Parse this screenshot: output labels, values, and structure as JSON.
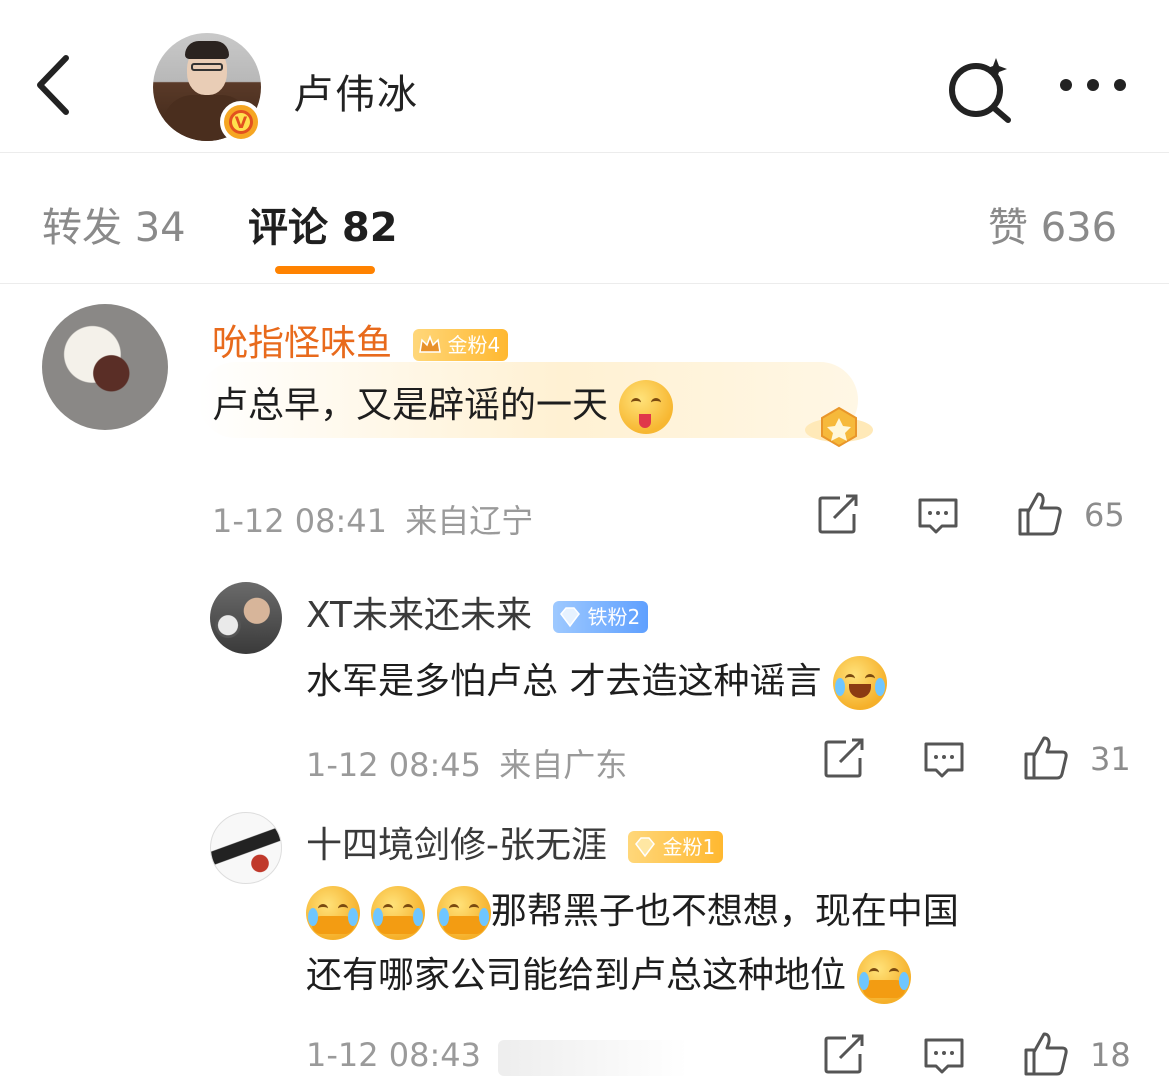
{
  "header": {
    "title": "卢伟冰",
    "back_icon": "chevron-left-icon",
    "search_icon": "search-sparkle-icon",
    "more_icon": "more-dots-icon"
  },
  "tabs": [
    {
      "label": "转发 34"
    },
    {
      "label": "评论 82"
    },
    {
      "label": "赞 636"
    }
  ],
  "colors": {
    "accent": "#ff8200",
    "username_orange": "#e86a1c",
    "username_gray": "#3a3a3a"
  },
  "comments": [
    {
      "username": "吮指怪味鱼",
      "badge": "金粉4",
      "text": "卢总早，又是辟谣的一天",
      "time": "1-12 08:41",
      "location": "来自辽宁",
      "likes": "65"
    },
    {
      "username": "XT未来还未来",
      "badge": "铁粉2",
      "text": "水军是多怕卢总 才去造这种谣言",
      "time": "1-12 08:45",
      "location": "来自广东",
      "likes": "31"
    },
    {
      "username": "十四境剑修-张无涯",
      "badge": "金粉1",
      "text_line1": "那帮黑子也不想想，现在中国",
      "text_line2": "还有哪家公司能给到卢总这种地位",
      "time": "1-12 08:43",
      "likes": "18"
    }
  ]
}
